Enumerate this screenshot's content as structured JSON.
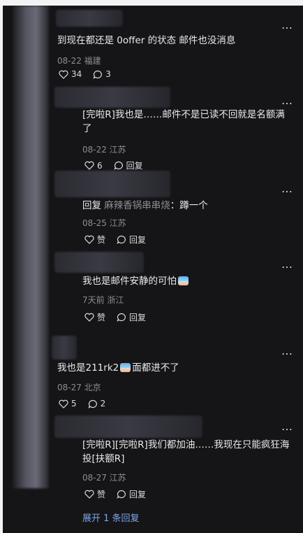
{
  "comments": [
    {
      "text": "到现在都还是 0offer 的状态 邮件也没消息",
      "meta": "08-22 福建",
      "likes": "34",
      "replies": "3"
    },
    {
      "text": "[完啦R]我也是……邮件不是已读不回就是名额满了",
      "meta": "08-22 江苏",
      "likes": "6",
      "reply_label": "回复"
    },
    {
      "reply_prefix": "回复",
      "reply_to": "麻辣香锅串串烧",
      "text": "：蹲一个",
      "meta": "08-25 江苏",
      "like_label": "赞",
      "reply_label": "回复"
    },
    {
      "text": "我也是邮件安静的可怕",
      "meta": "7天前 浙江",
      "like_label": "赞",
      "reply_label": "回复"
    },
    {
      "text_a": "我也是211rk2",
      "text_b": "面都进不了",
      "meta": "08-27 北京",
      "likes": "5",
      "replies": "2"
    },
    {
      "text": "[完啦R][完啦R]我们都加油……我现在只能疯狂海投[扶额R]",
      "meta": "08-27 江苏",
      "like_label": "赞",
      "reply_label": "回复"
    }
  ],
  "more_icon": "…",
  "expand_label": "展开 1 条回复"
}
